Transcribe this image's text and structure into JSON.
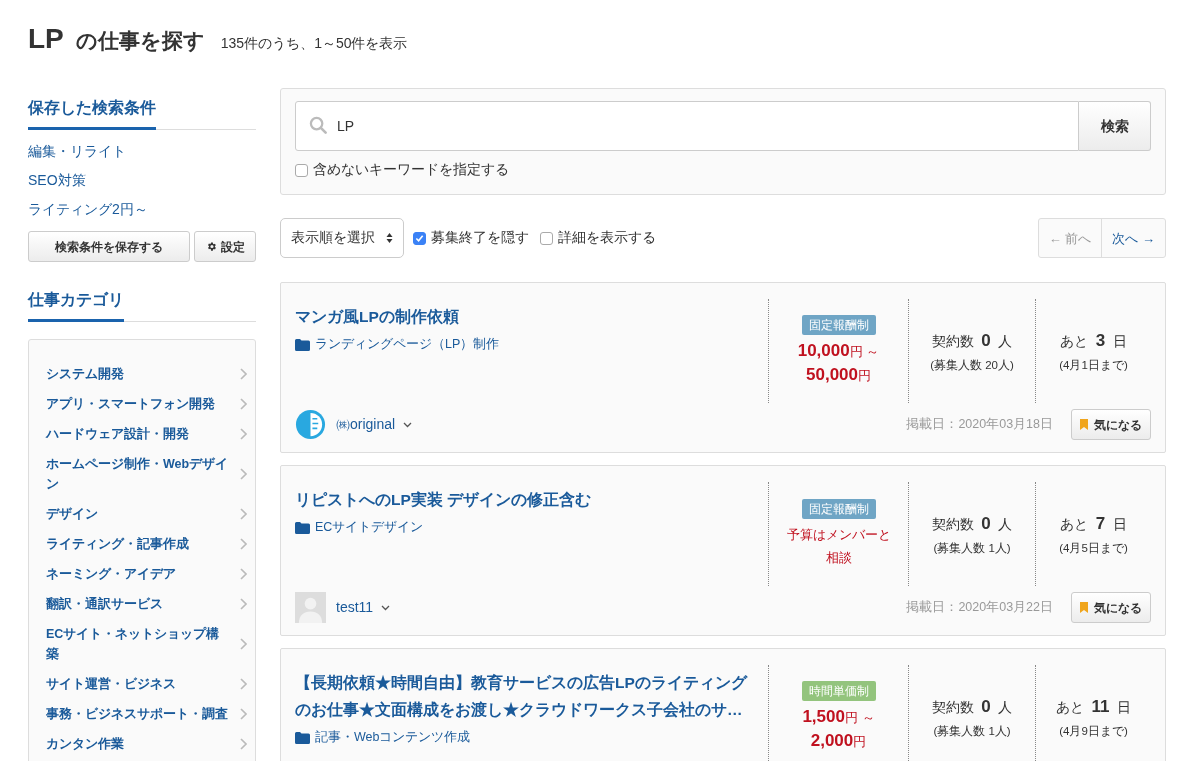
{
  "header": {
    "keyword": "LP",
    "title": "の仕事を探す",
    "count": "135件のうち、1～50件を表示"
  },
  "sidebar": {
    "saved_heading": "保存した検索条件",
    "saved_items": [
      "編集・リライト",
      "SEO対策",
      "ライティング2円～"
    ],
    "save_button": "検索条件を保存する",
    "settings_button": "設定",
    "category_heading": "仕事カテゴリ",
    "categories": [
      "システム開発",
      "アプリ・スマートフォン開発",
      "ハードウェア設計・開発",
      "ホームページ制作・Webデザイン",
      "デザイン",
      "ライティング・記事作成",
      "ネーミング・アイデア",
      "翻訳・通訳サービス",
      "ECサイト・ネットショップ構築",
      "サイト運営・ビジネス",
      "事務・ビジネスサポート・調査",
      "カンタン作業"
    ]
  },
  "search": {
    "value": "LP",
    "button": "検索",
    "exclude_label": "含めないキーワードを指定する",
    "exclude_checked": false
  },
  "toolbar": {
    "sort_label": "表示順を選択",
    "hide_closed_label": "募集終了を隠す",
    "hide_closed_checked": true,
    "details_label": "詳細を表示する",
    "details_checked": false,
    "prev": {
      "label": "← 前へ",
      "disabled": true
    },
    "next": {
      "label": "次へ →",
      "disabled": false
    }
  },
  "jobs": [
    {
      "title": "マンガ風LPの制作依頼",
      "category": "ランディングページ（LP）制作",
      "pay_type": {
        "label": "固定報酬制",
        "color": "#6fa5c5"
      },
      "pay": [
        "**10,000**円 ～",
        "**50,000**円"
      ],
      "contracts": "契約数 **0** 人",
      "applicants": "(募集人数 20人)",
      "remaining": "あと **3** 日",
      "deadline": "(4月1日まで)",
      "client": {
        "kind": "logo",
        "name": "㈱original"
      },
      "posted": "掲載日：2020年03月18日",
      "bookmark": "気になる"
    },
    {
      "title": "リピストへのLP実装 デザインの修正含む",
      "category": "ECサイトデザイン",
      "pay_type": {
        "label": "固定報酬制",
        "color": "#6fa5c5"
      },
      "pay": [
        "予算はメンバーと",
        "相談"
      ],
      "contracts": "契約数 **0** 人",
      "applicants": "(募集人数 1人)",
      "remaining": "あと **7** 日",
      "deadline": "(4月5日まで)",
      "client": {
        "kind": "placeholder",
        "name": "test11"
      },
      "posted": "掲載日：2020年03月22日",
      "bookmark": "気になる"
    },
    {
      "title": "【長期依頼★時間自由】教育サービスの広告LPのライティングのお仕事★文面構成をお渡し★クラウドワークス子会社のサ…",
      "category": "記事・Webコンテンツ作成",
      "pay_type": {
        "label": "時間単価制",
        "color": "#93c47d"
      },
      "pay": [
        "**1,500**円 ～",
        "**2,000**円"
      ],
      "contracts": "契約数 **0** 人",
      "applicants": "(募集人数 1人)",
      "remaining": "あと **11** 日",
      "deadline": "(4月9日まで)"
    }
  ]
}
